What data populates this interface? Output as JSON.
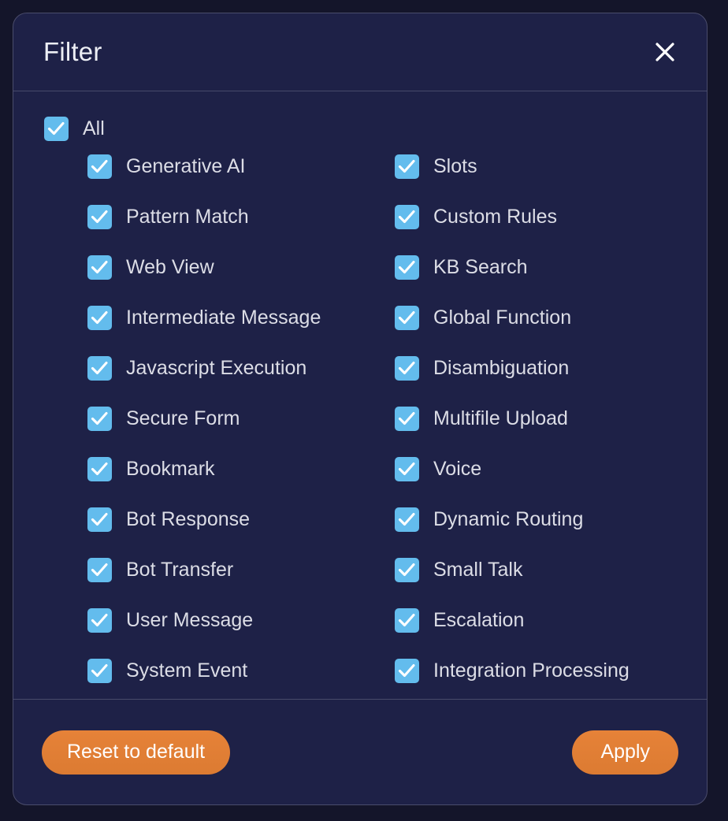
{
  "dialog": {
    "title": "Filter",
    "close_icon": "close-icon"
  },
  "colors": {
    "overlay_bg": "#14152a",
    "dialog_bg": "#1e2147",
    "dialog_border": "#4a4c6b",
    "divider": "#474a6a",
    "checkbox_fill": "#63bced",
    "checkmark": "#ffffff",
    "label_text": "#dcdde6",
    "title_text": "#eceef4",
    "button_orange": "#e07c33",
    "button_text": "#ffffff"
  },
  "select_all": {
    "label": "All",
    "checked": true
  },
  "options": [
    {
      "label": "Generative AI",
      "checked": true,
      "column": "left"
    },
    {
      "label": "Slots",
      "checked": true,
      "column": "right"
    },
    {
      "label": "Pattern Match",
      "checked": true,
      "column": "left"
    },
    {
      "label": "Custom Rules",
      "checked": true,
      "column": "right"
    },
    {
      "label": "Web View",
      "checked": true,
      "column": "left"
    },
    {
      "label": "KB Search",
      "checked": true,
      "column": "right"
    },
    {
      "label": "Intermediate Message",
      "checked": true,
      "column": "left"
    },
    {
      "label": "Global Function",
      "checked": true,
      "column": "right"
    },
    {
      "label": "Javascript Execution",
      "checked": true,
      "column": "left"
    },
    {
      "label": "Disambiguation",
      "checked": true,
      "column": "right"
    },
    {
      "label": "Secure Form",
      "checked": true,
      "column": "left"
    },
    {
      "label": "Multifile Upload",
      "checked": true,
      "column": "right"
    },
    {
      "label": "Bookmark",
      "checked": true,
      "column": "left"
    },
    {
      "label": "Voice",
      "checked": true,
      "column": "right"
    },
    {
      "label": "Bot Response",
      "checked": true,
      "column": "left"
    },
    {
      "label": "Dynamic Routing",
      "checked": true,
      "column": "right"
    },
    {
      "label": "Bot Transfer",
      "checked": true,
      "column": "left"
    },
    {
      "label": "Small Talk",
      "checked": true,
      "column": "right"
    },
    {
      "label": "User Message",
      "checked": true,
      "column": "left"
    },
    {
      "label": "Escalation",
      "checked": true,
      "column": "right"
    },
    {
      "label": "System Event",
      "checked": true,
      "column": "left"
    },
    {
      "label": "Integration Processing",
      "checked": true,
      "column": "right"
    }
  ],
  "footer": {
    "reset_label": "Reset to default",
    "apply_label": "Apply"
  }
}
